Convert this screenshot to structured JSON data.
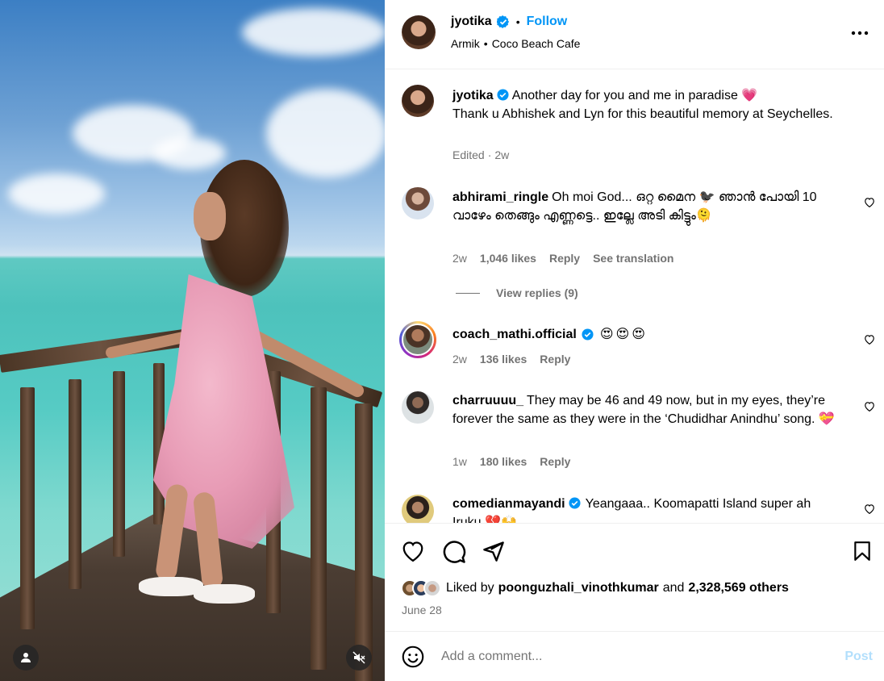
{
  "post_header": {
    "username": "jyotika",
    "separator": "•",
    "follow_label": "Follow",
    "location_part1": "Armik",
    "location_sep": "•",
    "location_part2": "Coco Beach Cafe"
  },
  "caption": {
    "username": "jyotika",
    "text_line1": "Another day for you and me in paradise",
    "emoji1": "💗",
    "text_line2": "Thank u Abhishek and Lyn for this beautiful memory at Seychelles.",
    "edited": "Edited",
    "dot": "·",
    "time": "2w"
  },
  "comments": [
    {
      "username": "abhirami_ringle",
      "text": "Oh moi God... ഒറ്റ മൈന 🐦‍⬛ ഞാൻ പോയി 10 വാഴേം തെങ്ങും എണ്ണട്ടെ.. ഇല്ലേ അടി കിട്ടും🫠",
      "time": "2w",
      "likes": "1,046 likes",
      "reply": "Reply",
      "translate": "See translation",
      "view_replies": "View replies (9)"
    },
    {
      "username": "coach_mathi.official",
      "text": "😍😍😍",
      "time": "2w",
      "likes": "136 likes",
      "reply": "Reply"
    },
    {
      "username": "charruuuu_",
      "text": "They may be 46 and 49 now, but in my eyes, they’re forever the same as they were in the ‘Chudidhar Anindhu’ song. 💝",
      "time": "1w",
      "likes": "180 likes",
      "reply": "Reply"
    },
    {
      "username": "comedianmayandi",
      "text": "Yeangaaa.. Koomapatti Island super ah Iruku 💔🙌"
    }
  ],
  "likes": {
    "prefix": "Liked by",
    "user": "poonguzhali_vinothkumar",
    "and": "and",
    "others": "2,328,569 others"
  },
  "date": "June 28",
  "add_comment": {
    "placeholder": "Add a comment...",
    "post_label": "Post"
  },
  "icons": [
    "verified-icon",
    "more-icon",
    "heart-icon",
    "comment-icon",
    "share-icon",
    "bookmark-icon",
    "emoji-icon",
    "user-tag-icon",
    "mute-icon"
  ],
  "colors": {
    "follow": "#0095f6",
    "verified": "#0095f6",
    "secondary_text": "#737373",
    "post_disabled": "#b2dffc",
    "border": "#efefef"
  }
}
